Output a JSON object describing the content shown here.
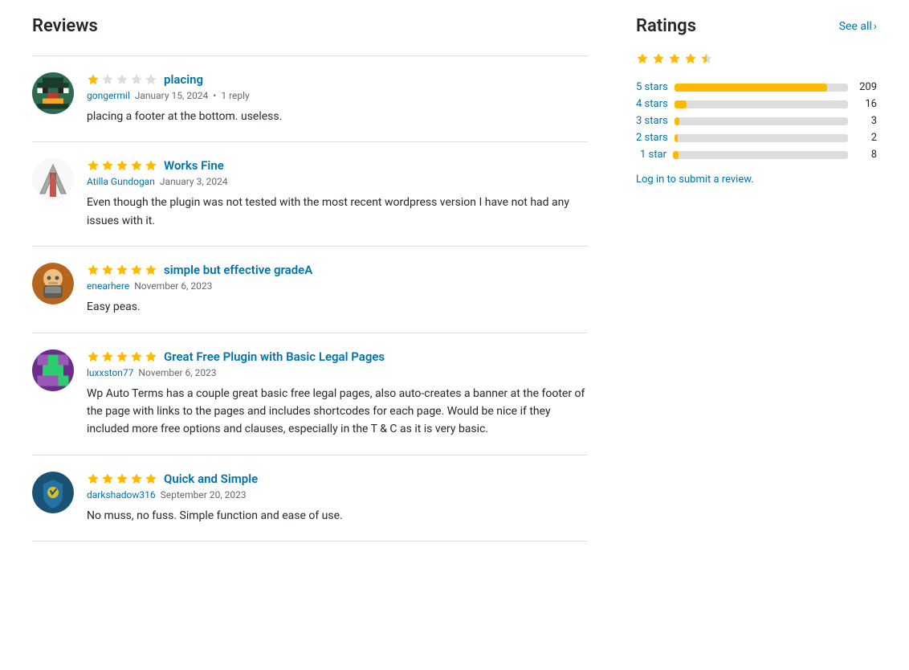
{
  "reviews_title": "Reviews",
  "ratings_title": "Ratings",
  "see_all_label": "See all",
  "overall_rating": 4.5,
  "rating_bars": [
    {
      "label": "5 stars",
      "count": 209,
      "pct": 88
    },
    {
      "label": "4 stars",
      "count": 16,
      "pct": 7
    },
    {
      "label": "3 stars",
      "count": 3,
      "pct": 3
    },
    {
      "label": "2 stars",
      "count": 2,
      "pct": 2
    },
    {
      "label": "1 star",
      "count": 8,
      "pct": 3
    }
  ],
  "log_in_text": "Log in to submit a review.",
  "reviews": [
    {
      "id": "placing",
      "title": "placing",
      "reviewer": "gongermil",
      "date": "January 15, 2024",
      "reply": "1 reply",
      "body": "placing a footer at the bottom. useless.",
      "stars": 1,
      "avatar_type": "pixel-green"
    },
    {
      "id": "works-fine",
      "title": "Works Fine",
      "reviewer": "Atilla Gundogan",
      "date": "January 3, 2024",
      "reply": "",
      "body": "Even though the plugin was not tested with the most recent wordpress version I have not had any issues with it.",
      "stars": 5,
      "avatar_type": "atilla"
    },
    {
      "id": "simple-but-effective",
      "title": "simple but effective gradeA",
      "reviewer": "enearhere",
      "date": "November 6, 2023",
      "reply": "",
      "body": "Easy peas.",
      "stars": 5,
      "avatar_type": "beard"
    },
    {
      "id": "great-free-plugin",
      "title": "Great Free Plugin with Basic Legal Pages",
      "reviewer": "luxxston77",
      "date": "November 6, 2023",
      "reply": "",
      "body": "Wp Auto Terms has a couple great basic free legal pages, also auto-creates a banner at the footer of the page with links to the pages and includes shortcodes for each page. Would be nice if they included more free options and clauses, especially in the T & C as it is very basic.",
      "stars": 5,
      "avatar_type": "pixel-purple"
    },
    {
      "id": "quick-and-simple",
      "title": "Quick and Simple",
      "reviewer": "darkshadow316",
      "date": "September 20, 2023",
      "reply": "",
      "body": "No muss, no fuss. Simple function and ease of use.",
      "stars": 5,
      "avatar_type": "blue-shield"
    }
  ]
}
